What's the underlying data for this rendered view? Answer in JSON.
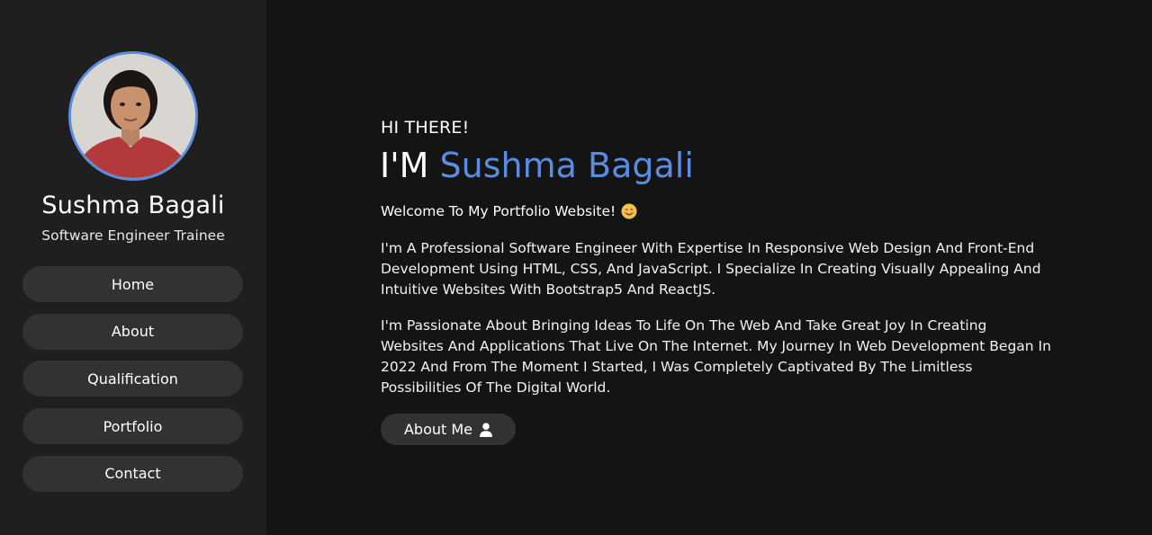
{
  "colors": {
    "accent": "#5a8ce0",
    "sidebar_bg": "#1f1f1f",
    "main_bg": "#141414",
    "button_bg": "#323232"
  },
  "profile": {
    "name": "Sushma Bagali",
    "role": "Software Engineer Trainee",
    "avatar_icon": "profile-photo"
  },
  "nav": {
    "items": [
      {
        "label": "Home"
      },
      {
        "label": "About"
      },
      {
        "label": "Qualification"
      },
      {
        "label": "Portfolio"
      },
      {
        "label": "Contact"
      }
    ]
  },
  "hero": {
    "greeting": "HI THERE!",
    "headline_prefix": "I'M",
    "headline_name": "Sushma Bagali",
    "welcome": "Welcome To My Portfolio Website!",
    "welcome_icon": "smiling-face-emoji",
    "paragraph_1": "I'm A Professional Software Engineer With Expertise In Responsive Web Design And Front-End Development Using HTML, CSS, And JavaScript. I Specialize In Creating Visually Appealing And Intuitive Websites With Bootstrap5 And ReactJS.",
    "paragraph_2": "I'm Passionate About Bringing Ideas To Life On The Web And Take Great Joy In Creating Websites And Applications That Live On The Internet. My Journey In Web Development Began In 2022 And From The Moment I Started, I Was Completely Captivated By The Limitless Possibilities Of The Digital World.",
    "cta_label": "About Me",
    "cta_icon": "user-icon"
  }
}
